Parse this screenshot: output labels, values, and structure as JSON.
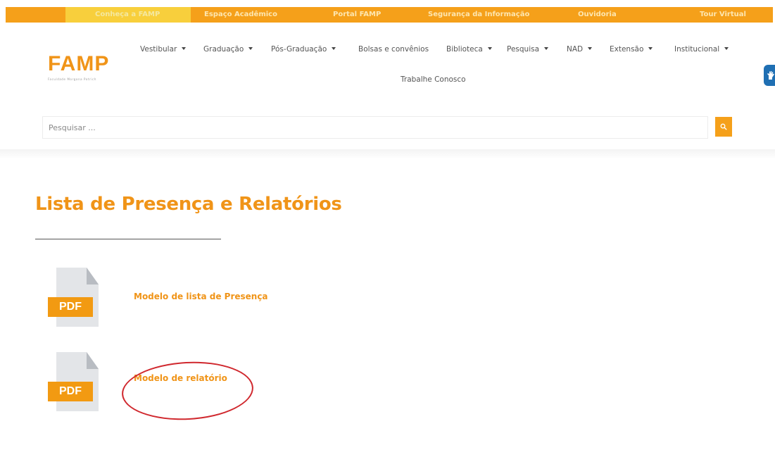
{
  "topbar": {
    "color": "#f5a01a",
    "highlight_color": "#f8cf3c",
    "links": [
      "Conheça a FAMP",
      "Espaço Acadêmico",
      "Portal FAMP",
      "Segurança da Informação",
      "Ouvidoria",
      "Tour Virtual"
    ]
  },
  "logo": {
    "wordmark": "FAMP",
    "tagline": "Faculdade Morgana Potrich"
  },
  "nav": {
    "items": [
      "Vestibular",
      "Graduação",
      "Pós-Graduação",
      "Bolsas e convênios",
      "Biblioteca",
      "Pesquisa",
      "NAD",
      "Extensão",
      "Institucional"
    ],
    "second_row": "Trabalhe Conosco"
  },
  "search": {
    "placeholder": "Pesquisar ...",
    "value": "",
    "button_icon": "search-icon"
  },
  "page": {
    "title": "Lista de Presença e Relatórios"
  },
  "documents": [
    {
      "icon_label": "PDF",
      "title": "Modelo de lista de Presença"
    },
    {
      "icon_label": "PDF",
      "title": "Modelo de relatório"
    }
  ],
  "accent_color": "#f09418",
  "annotation_color": "#d0282e"
}
